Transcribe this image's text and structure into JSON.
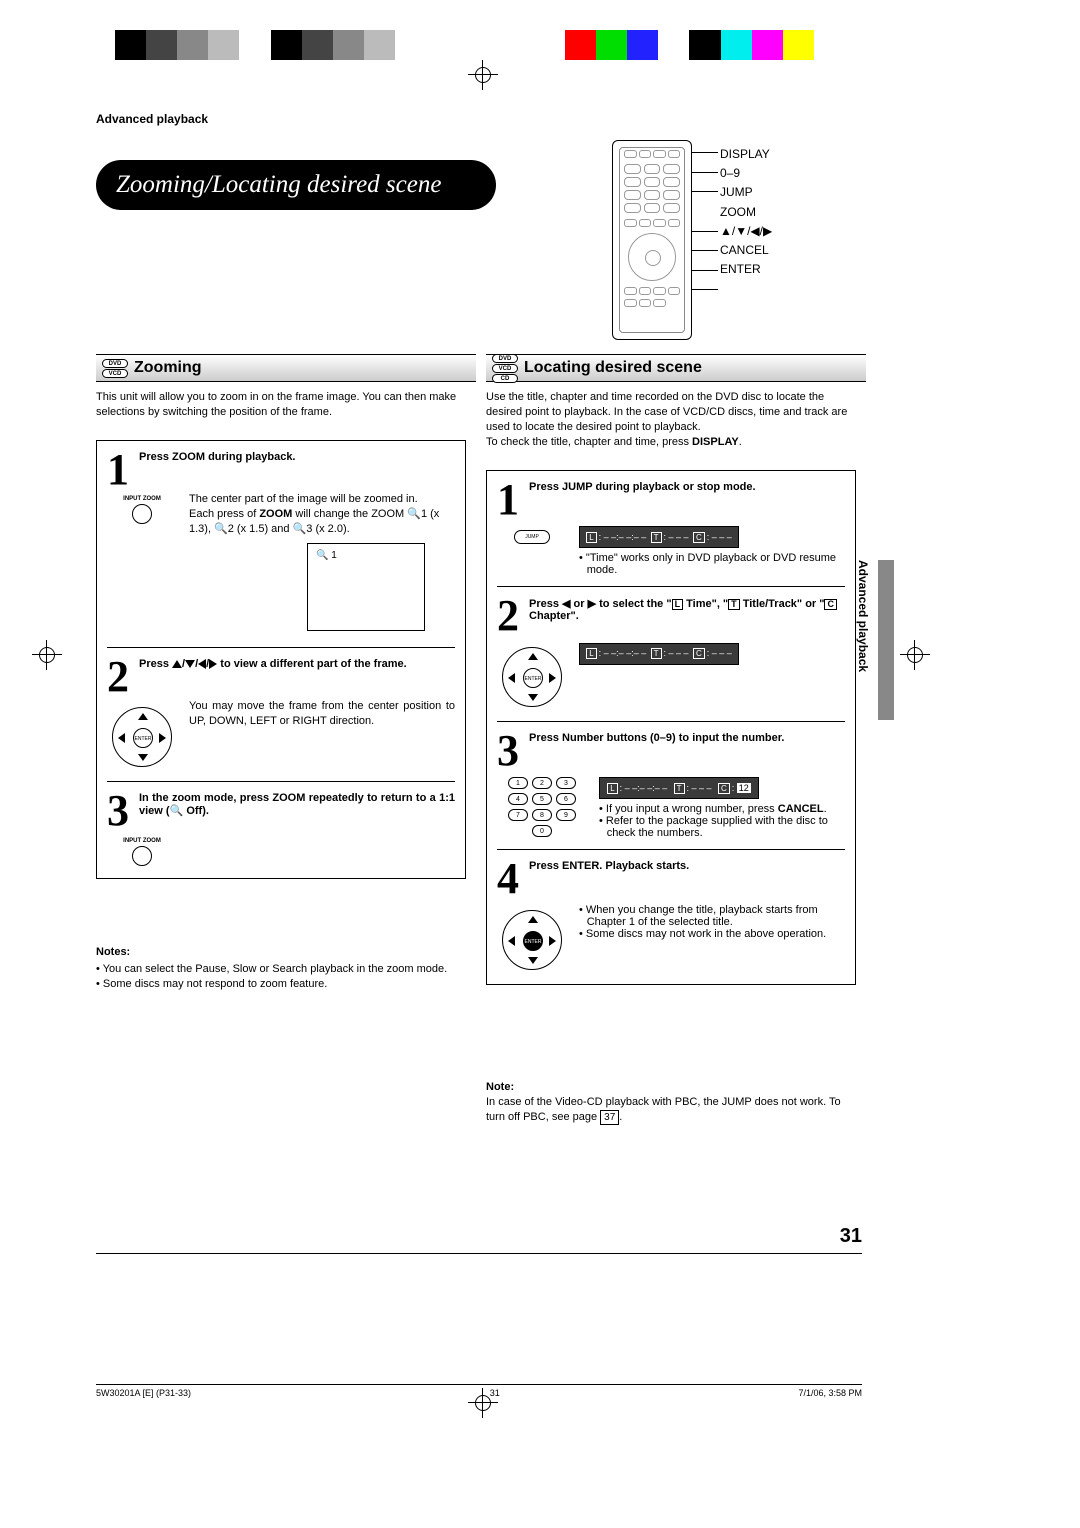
{
  "header": {
    "section": "Advanced playback"
  },
  "title": "Zooming/Locating desired scene",
  "remote_labels": [
    "DISPLAY",
    "0–9",
    "JUMP",
    "ZOOM",
    "▲/▼/◀/▶",
    "CANCEL",
    "ENTER"
  ],
  "left": {
    "heading": "Zooming",
    "badges": [
      "DVD",
      "VCD"
    ],
    "intro": "This unit will allow you to zoom in on the frame image. You can then make selections by switching the position of the frame.",
    "step1": {
      "head": "Press ZOOM during playback.",
      "desc1": "The center part of the image will be zoomed in.",
      "desc2_a": "Each press of ",
      "desc2_zoom": "ZOOM",
      "desc2_b": " will change the ZOOM 🔍1 (x 1.3), 🔍2 (x 1.5) and 🔍3 (x 2.0).",
      "zoom_label": "INPUT ZOOM",
      "screen_label": "🔍 1"
    },
    "step2": {
      "head": "Press ▲/▼/◀/▶ to view a different part of the frame.",
      "desc": "You may move the frame from the center position to UP, DOWN, LEFT or RIGHT direction."
    },
    "step3": {
      "head": "In the zoom mode, press ZOOM repeatedly to return to a 1:1 view (🔍 Off).",
      "zoom_label": "INPUT ZOOM"
    },
    "notes_head": "Notes:",
    "notes": [
      "You can select the Pause, Slow or Search playback in the zoom mode.",
      "Some discs may not respond to zoom feature."
    ]
  },
  "right": {
    "heading": "Locating desired scene",
    "badges": [
      "DVD",
      "VCD",
      "CD"
    ],
    "intro1": "Use the title, chapter and time recorded on the DVD disc to locate the desired point to playback. In the case of VCD/CD discs, time and track are used to locate the desired point to playback.",
    "intro2_a": "To check the title, chapter and time, press ",
    "intro2_b": "DISPLAY",
    "intro2_c": ".",
    "step1": {
      "head": "Press JUMP during playback or stop mode.",
      "jump_label": "JUMP",
      "osd": {
        "L": "– –:– –:– –",
        "T": "– – –",
        "C": "– – –"
      },
      "bullet": "\"Time\" works only in DVD playback or DVD resume mode."
    },
    "step2": {
      "head_a": "Press ◀ or ▶ to select the \"",
      "head_b": " Time\", \"",
      "head_c": " Title/Track\" or \"",
      "head_d": " Chapter\".",
      "osd": {
        "L": "– –:– –:– –",
        "T": "– – –",
        "C": "– – –"
      }
    },
    "step3": {
      "head": "Press Number buttons (0–9) to input the number.",
      "osd": {
        "L": "– –:– –:– –",
        "T": "– – –",
        "C": " 12 "
      },
      "bullets_a": "If you input a wrong number, press ",
      "bullets_cancel": "CANCEL",
      "bullets_b": ".",
      "bullet2": "Refer to the package supplied with the disc to check the numbers."
    },
    "step4": {
      "head": "Press ENTER. Playback starts.",
      "bullets": [
        "When you change the title, playback starts from Chapter 1 of the selected title.",
        "Some discs may not work in the above operation."
      ]
    },
    "note_head": "Note:",
    "note_a": "In case of the Video-CD playback with PBC, the JUMP does not work. To turn off PBC, see page ",
    "note_page": "37",
    "note_b": "."
  },
  "side_tab": "Advanced playback",
  "page_number": "31",
  "footer": {
    "left": "5W30201A [E] (P31-33)",
    "mid": "31",
    "right": "7/1/06, 3:58 PM"
  }
}
